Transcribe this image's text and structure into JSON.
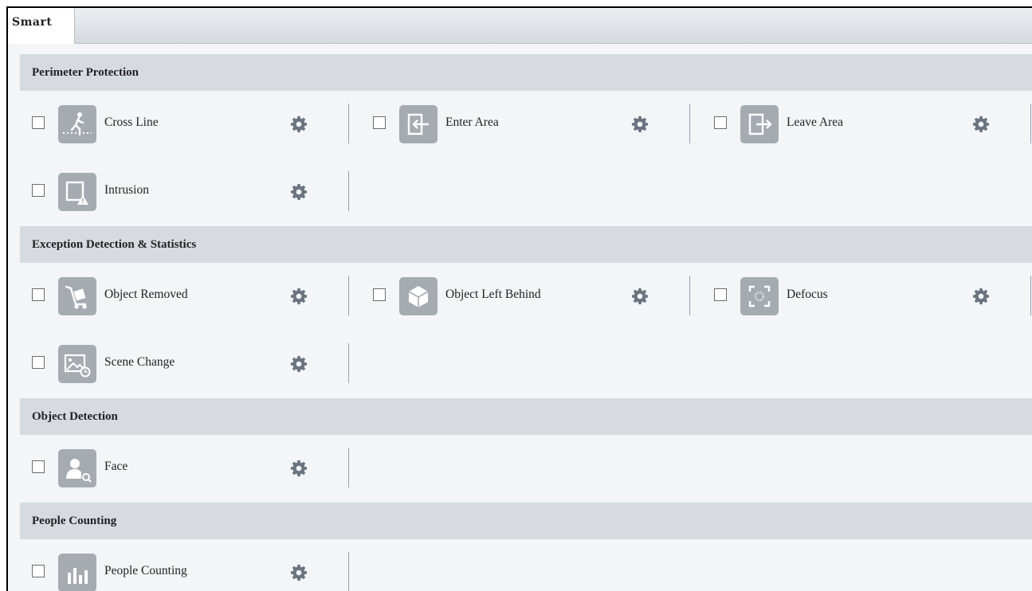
{
  "tab": {
    "label": "Smart"
  },
  "sections": [
    {
      "title": "Perimeter Protection",
      "items": [
        {
          "label": "Cross Line",
          "icon": "cross-line-icon"
        },
        {
          "label": "Enter Area",
          "icon": "enter-area-icon"
        },
        {
          "label": "Leave Area",
          "icon": "leave-area-icon"
        },
        {
          "label": "Intrusion",
          "icon": "intrusion-icon"
        }
      ]
    },
    {
      "title": "Exception Detection & Statistics",
      "items": [
        {
          "label": "Object Removed",
          "icon": "object-removed-icon"
        },
        {
          "label": "Object Left Behind",
          "icon": "object-left-behind-icon"
        },
        {
          "label": "Defocus",
          "icon": "defocus-icon"
        },
        {
          "label": "Scene Change",
          "icon": "scene-change-icon"
        }
      ]
    },
    {
      "title": "Object Detection",
      "items": [
        {
          "label": "Face",
          "icon": "face-icon"
        }
      ]
    },
    {
      "title": "People Counting",
      "items": [
        {
          "label": "People Counting",
          "icon": "people-counting-icon"
        }
      ]
    }
  ],
  "colors": {
    "section_header_bg": "#d7dbe1",
    "icon_tile_bg": "#a6abb1",
    "gear_color": "#6b7480",
    "panel_bg": "#f4f5f7"
  }
}
